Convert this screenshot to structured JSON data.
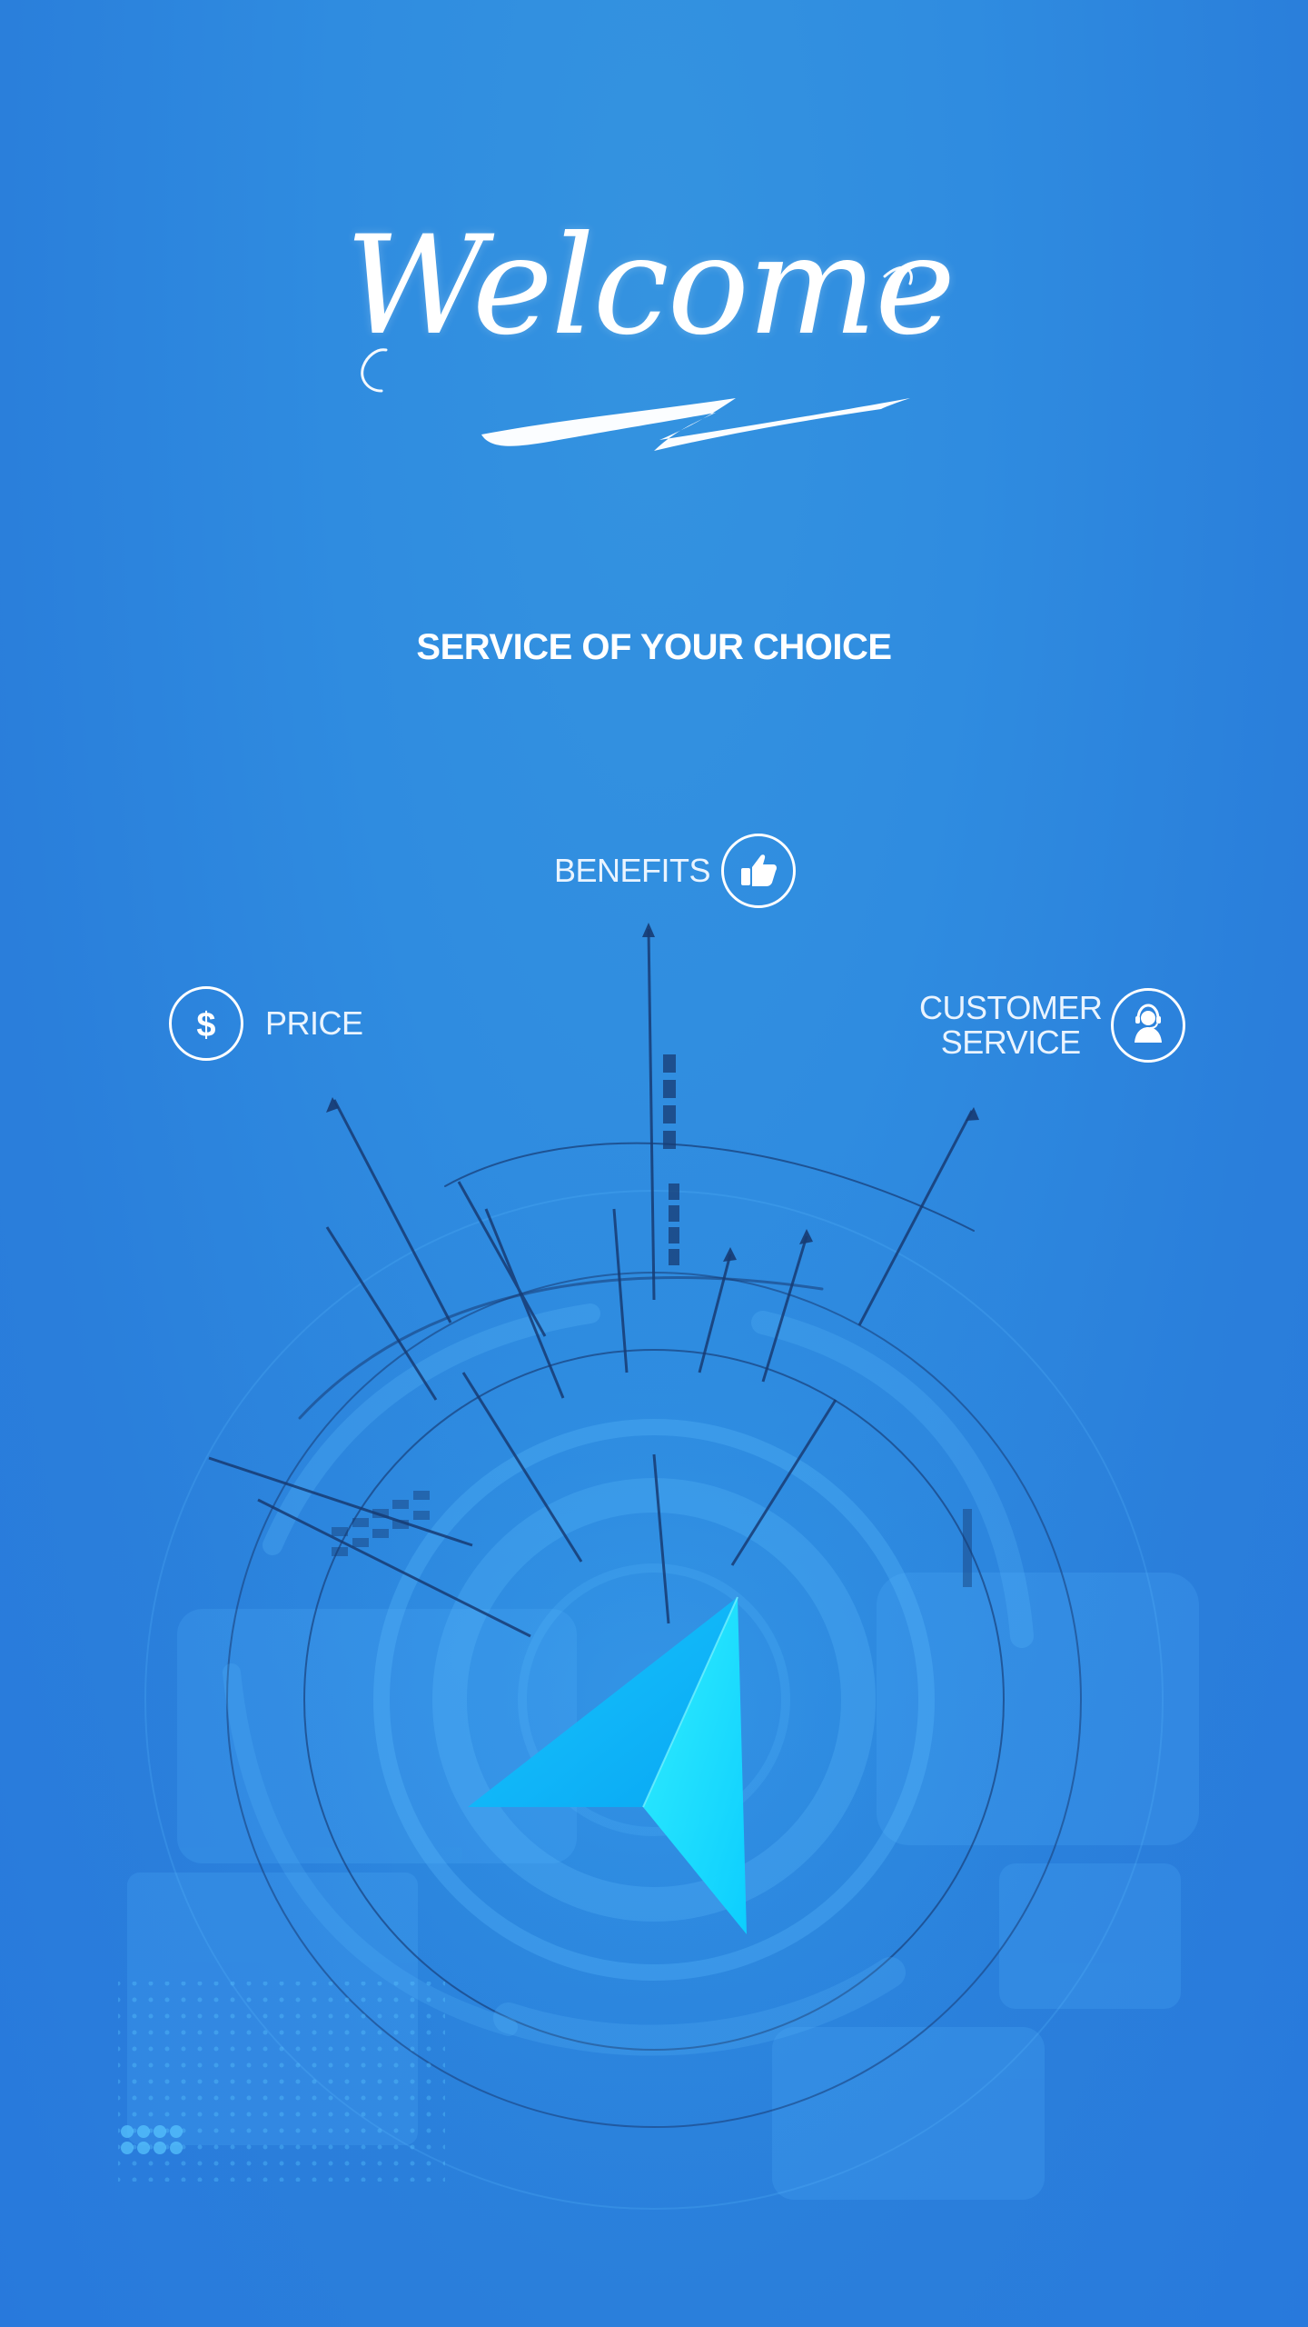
{
  "hero": {
    "title": "Welcome",
    "subtitle": "SERVICE OF YOUR CHOICE"
  },
  "features": {
    "price": {
      "label": "PRICE",
      "icon": "dollar-icon"
    },
    "benefits": {
      "label": "BENEFITS",
      "icon": "thumbs-up-icon"
    },
    "customer_service": {
      "label_line1": "CUSTOMER",
      "label_line2": "SERVICE",
      "icon": "support-headset-icon"
    }
  },
  "colors": {
    "background": "#2f8ce0",
    "text": "#ffffff",
    "accent_cyan": "#17e3ff"
  }
}
